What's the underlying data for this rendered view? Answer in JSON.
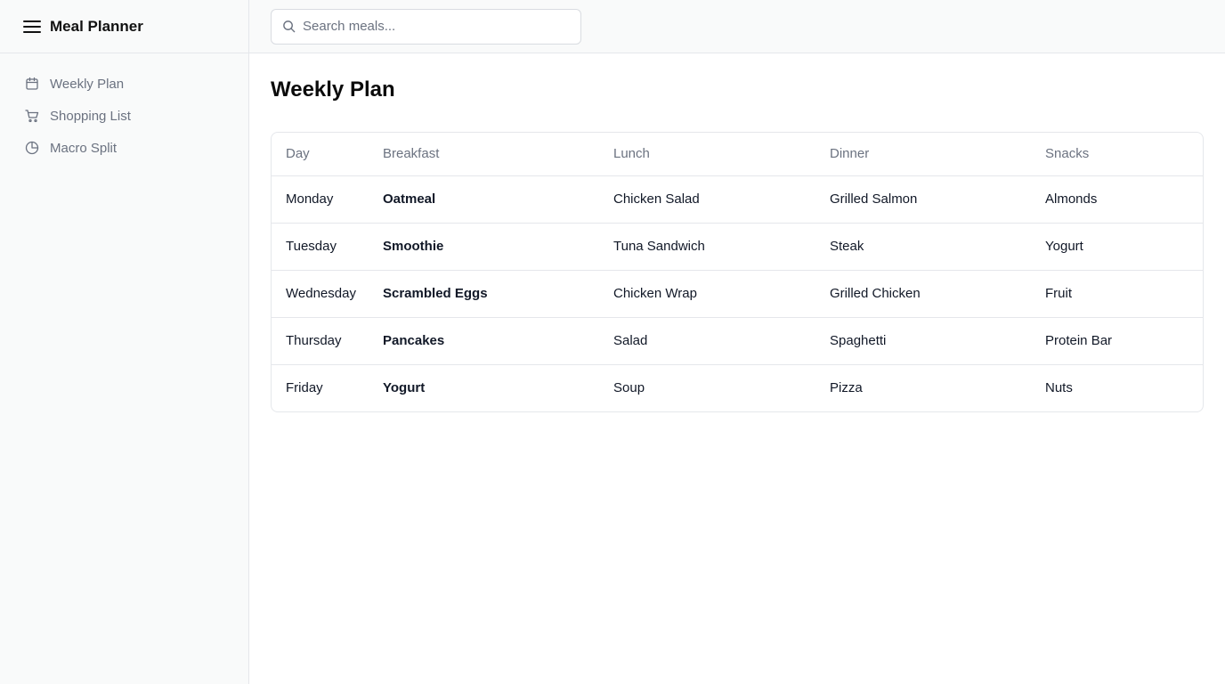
{
  "app": {
    "title": "Meal Planner"
  },
  "icons": {
    "menu": "menu-icon",
    "search": "search-icon",
    "calendar": "calendar-icon",
    "cart": "cart-icon",
    "pie": "pie-chart-icon"
  },
  "sidebar": {
    "items": [
      {
        "label": "Weekly Plan",
        "icon": "calendar-icon"
      },
      {
        "label": "Shopping List",
        "icon": "cart-icon"
      },
      {
        "label": "Macro Split",
        "icon": "pie-chart-icon"
      }
    ]
  },
  "search": {
    "placeholder": "Search meals...",
    "value": ""
  },
  "page": {
    "title": "Weekly Plan"
  },
  "table": {
    "headers": {
      "day": "Day",
      "breakfast": "Breakfast",
      "lunch": "Lunch",
      "dinner": "Dinner",
      "snacks": "Snacks"
    },
    "rows": [
      {
        "day": "Monday",
        "breakfast": "Oatmeal",
        "lunch": "Chicken Salad",
        "dinner": "Grilled Salmon",
        "snacks": "Almonds"
      },
      {
        "day": "Tuesday",
        "breakfast": "Smoothie",
        "lunch": "Tuna Sandwich",
        "dinner": "Steak",
        "snacks": "Yogurt"
      },
      {
        "day": "Wednesday",
        "breakfast": "Scrambled Eggs",
        "lunch": "Chicken Wrap",
        "dinner": "Grilled Chicken",
        "snacks": "Fruit"
      },
      {
        "day": "Thursday",
        "breakfast": "Pancakes",
        "lunch": "Salad",
        "dinner": "Spaghetti",
        "snacks": "Protein Bar"
      },
      {
        "day": "Friday",
        "breakfast": "Yogurt",
        "lunch": "Soup",
        "dinner": "Pizza",
        "snacks": "Nuts"
      }
    ]
  },
  "colors": {
    "sidebar_bg": "#f9fafa",
    "border": "#e5e7eb",
    "muted_text": "#6b7280",
    "text": "#111827"
  }
}
